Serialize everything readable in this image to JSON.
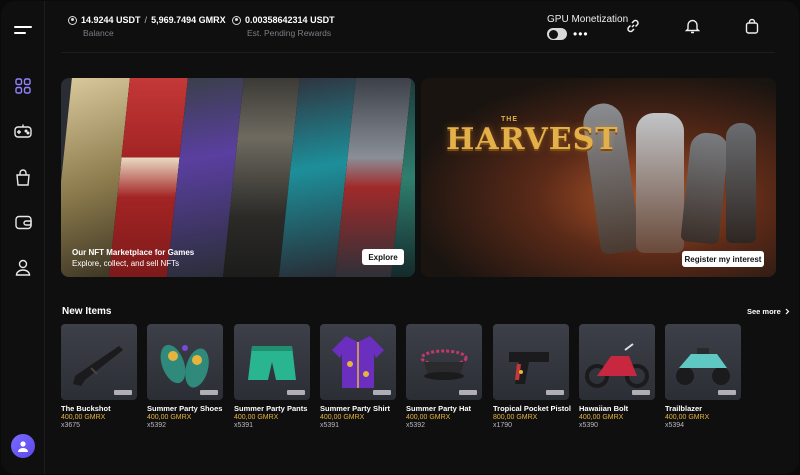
{
  "header": {
    "balance_value": "14.9244 USDT",
    "balance_sep": "/",
    "balance_gmrx": "5,969.7494 GMRX",
    "balance_label": "Balance",
    "pending_value": "0.00358642314 USDT",
    "pending_label": "Est. Pending Rewards",
    "gpu_label": "GPU Monetization",
    "more_dots": "•••"
  },
  "banners": {
    "marketplace_title": "Our NFT Marketplace for Games",
    "marketplace_subtitle": "Explore, collect, and sell NFTs",
    "explore_button": "Explore",
    "harvest_the": "THE",
    "harvest_title": "HARVEST",
    "register_button": "Register my interest"
  },
  "new_items": {
    "title": "New Items",
    "see_more": "See more",
    "items": [
      {
        "name": "The Buckshot",
        "price": "400,00 GMRX",
        "count": "x3675"
      },
      {
        "name": "Summer Party Shoes",
        "price": "400,00 GMRX",
        "count": "x5392"
      },
      {
        "name": "Summer Party Pants",
        "price": "400,00 GMRX",
        "count": "x5391"
      },
      {
        "name": "Summer Party Shirt",
        "price": "400,00 GMRX",
        "count": "x5391"
      },
      {
        "name": "Summer Party Hat",
        "price": "400,00 GMRX",
        "count": "x5392"
      },
      {
        "name": "Tropical Pocket Pistol",
        "price": "800,00 GMRX",
        "count": "x1790"
      },
      {
        "name": "Hawaiian Bolt",
        "price": "400,00 GMRX",
        "count": "x5390"
      },
      {
        "name": "Trailblazer",
        "price": "400,00 GMRX",
        "count": "x5394"
      }
    ]
  },
  "colors": {
    "accent": "#7b6bff",
    "price": "#e6b43c",
    "background": "#0f0f10"
  }
}
